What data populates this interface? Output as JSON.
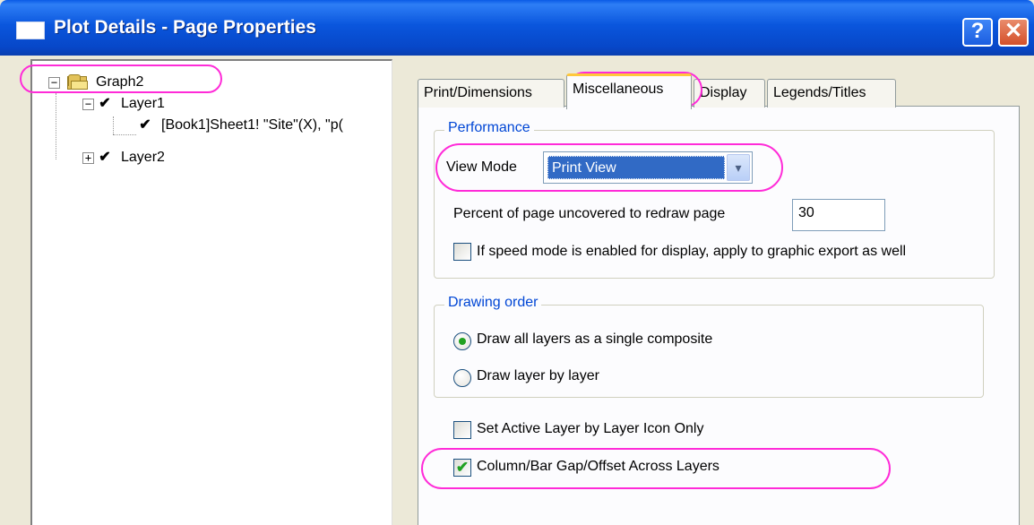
{
  "window": {
    "title": "Plot Details - Page Properties",
    "help_button": "?",
    "close_button": "✕"
  },
  "tree": {
    "root": {
      "label": "Graph2",
      "expander": "−"
    },
    "layer1": {
      "label": "Layer1",
      "expander": "−",
      "checked": "✔"
    },
    "dataset": {
      "label": "[Book1]Sheet1! \"Site\"(X), \"p(",
      "checked": "✔"
    },
    "layer2": {
      "label": "Layer2",
      "expander": "+",
      "checked": "✔"
    }
  },
  "tabs": [
    {
      "label": "Print/Dimensions"
    },
    {
      "label": "Miscellaneous"
    },
    {
      "label": "Display"
    },
    {
      "label": "Legends/Titles"
    }
  ],
  "performance": {
    "title": "Performance",
    "view_mode_label": "View Mode",
    "view_mode_value": "Print View",
    "dropdown_arrow": "▾",
    "percent_label": "Percent of page uncovered to redraw page",
    "percent_value": "30",
    "speed_mode_label": "If speed mode is enabled for display, apply to graphic export as well"
  },
  "drawing_order": {
    "title": "Drawing order",
    "option_composite": "Draw all layers as a single composite",
    "option_layer_by_layer": "Draw layer by layer",
    "selected": "composite"
  },
  "options": {
    "active_layer_label": "Set Active Layer by Layer Icon Only",
    "active_layer_checked": "",
    "column_bar_label": "Column/Bar Gap/Offset Across Layers",
    "column_bar_checked": "✔"
  },
  "colors": {
    "highlight": "#ff2bd8",
    "titlebar": "#0a56dd",
    "group_title": "#0046d5",
    "check_mark": "#21a121"
  }
}
